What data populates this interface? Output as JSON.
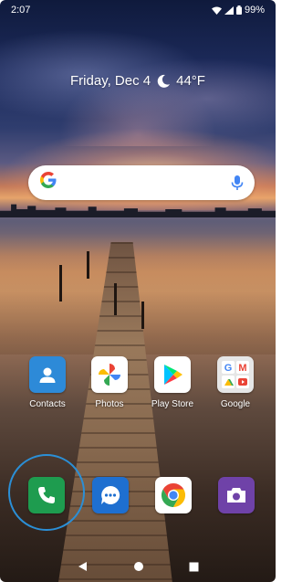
{
  "status_bar": {
    "time": "2:07",
    "battery": "99%"
  },
  "glance": {
    "date": "Friday, Dec 4",
    "weather_icon": "moon-icon",
    "temperature": "44°F"
  },
  "search": {
    "logo": "G",
    "icons": [
      "google-g-icon",
      "microphone-icon"
    ],
    "colors": {
      "blue": "#4285f4",
      "red": "#ea4335",
      "yellow": "#fbbc05",
      "green": "#34a853"
    }
  },
  "apps": [
    {
      "label": "Contacts",
      "icon": "contacts-icon",
      "color": "#2d8ad8"
    },
    {
      "label": "Photos",
      "icon": "photos-pinwheel-icon",
      "color": "#ffffff"
    },
    {
      "label": "Play Store",
      "icon": "play-store-icon",
      "color": "#ffffff"
    },
    {
      "label": "Google",
      "icon": "google-folder-icon",
      "color": "#e6e6e6"
    }
  ],
  "dock": [
    {
      "icon": "phone-icon",
      "color": "#1e9c4f",
      "highlighted": true
    },
    {
      "icon": "messages-icon",
      "color": "#1e6fd0"
    },
    {
      "icon": "chrome-icon",
      "color": "#ffffff"
    },
    {
      "icon": "camera-icon",
      "color": "#6f42a8"
    }
  ],
  "nav_bar": [
    "back-icon",
    "home-icon",
    "recents-icon"
  ]
}
